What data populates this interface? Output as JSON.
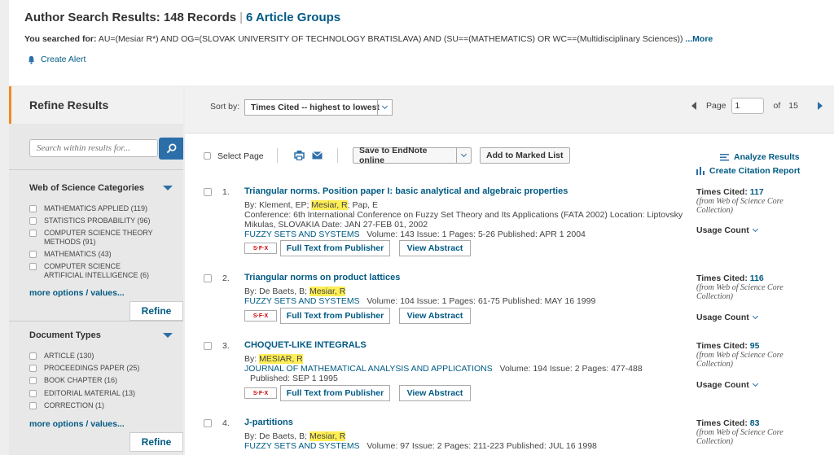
{
  "header": {
    "title": "Author Search Results: 148 Records",
    "groups": "6 Article Groups",
    "searched_label": "You searched for:",
    "query": "AU=(Mesiar R*) AND OG=(SLOVAK UNIVERSITY OF TECHNOLOGY BRATISLAVA) AND (SU==(MATHEMATICS) OR WC==(Multidisciplinary Sciences))",
    "more": "...More",
    "create_alert": "Create Alert"
  },
  "sidebar": {
    "title": "Refine Results",
    "search_placeholder": "Search within results for...",
    "facets": [
      {
        "title": "Web of Science Categories",
        "items": [
          "MATHEMATICS APPLIED (119)",
          "STATISTICS PROBABILITY (96)",
          "COMPUTER SCIENCE THEORY METHODS (91)",
          "MATHEMATICS (43)",
          "COMPUTER SCIENCE ARTIFICIAL INTELLIGENCE (6)"
        ],
        "more": "more options / values...",
        "refine": "Refine"
      },
      {
        "title": "Document Types",
        "items": [
          "ARTICLE (130)",
          "PROCEEDINGS PAPER (25)",
          "BOOK CHAPTER (16)",
          "EDITORIAL MATERIAL (13)",
          "CORRECTION (1)"
        ],
        "more": "more options / values...",
        "refine": "Refine"
      }
    ]
  },
  "sort": {
    "label": "Sort by:",
    "selected": "Times Cited -- highest to lowest"
  },
  "pager": {
    "page_label": "Page",
    "current": "1",
    "of_label": "of",
    "total": "15"
  },
  "toolbar": {
    "select_page": "Select Page",
    "save_endnote": "Save to EndNote online",
    "add_marked": "Add to Marked List",
    "analyze": "Analyze Results",
    "citation_report": "Create Citation Report"
  },
  "links": {
    "sfx": "S·F·X",
    "full_text": "Full Text from Publisher",
    "view_abstract": "View Abstract",
    "usage_count": "Usage Count",
    "times_cited_label": "Times Cited:",
    "core_note": "(from Web of Science Core Collection)"
  },
  "records": [
    {
      "num": "1.",
      "title": "Triangular norms. Position paper I: basic analytical and algebraic properties",
      "by_pre": "By: Klement, EP; ",
      "by_hl": "Mesiar, R",
      "by_post": "; Pap, E",
      "conf1": "Conference: 6th International Conference on Fuzzy Set Theory and Its Applications (FATA 2002) Location: Liptovsky",
      "conf2": "Mikulas, SLOVAKIA Date: JAN 27-FEB 01, 2002",
      "source": "FUZZY SETS AND SYSTEMS",
      "details": "Volume: 143   Issue: 1   Pages: 5-26   Published: APR 1 2004",
      "times_cited": "117"
    },
    {
      "num": "2.",
      "title": "Triangular norms on product lattices",
      "by_pre": "By: De Baets, B; ",
      "by_hl": "Mesiar, R",
      "by_post": "",
      "source": "FUZZY SETS AND SYSTEMS",
      "details": "Volume: 104   Issue: 1   Pages: 61-75   Published: MAY 16 1999",
      "times_cited": "116"
    },
    {
      "num": "3.",
      "title": "CHOQUET-LIKE INTEGRALS",
      "by_pre": "By: ",
      "by_hl": "MESIAR, R",
      "by_post": "",
      "source": "JOURNAL OF MATHEMATICAL ANALYSIS AND APPLICATIONS",
      "details": "Volume: 194   Issue: 2   Pages: 477-488",
      "details2": "Published: SEP 1 1995",
      "times_cited": "95"
    },
    {
      "num": "4.",
      "title": "J-partitions",
      "by_pre": "By: De Baets, B; ",
      "by_hl": "Mesiar, R",
      "by_post": "",
      "source": "FUZZY SETS AND SYSTEMS",
      "details": "Volume: 97   Issue: 2   Pages: 211-223   Published: JUL 16 1998",
      "times_cited": "83"
    }
  ]
}
